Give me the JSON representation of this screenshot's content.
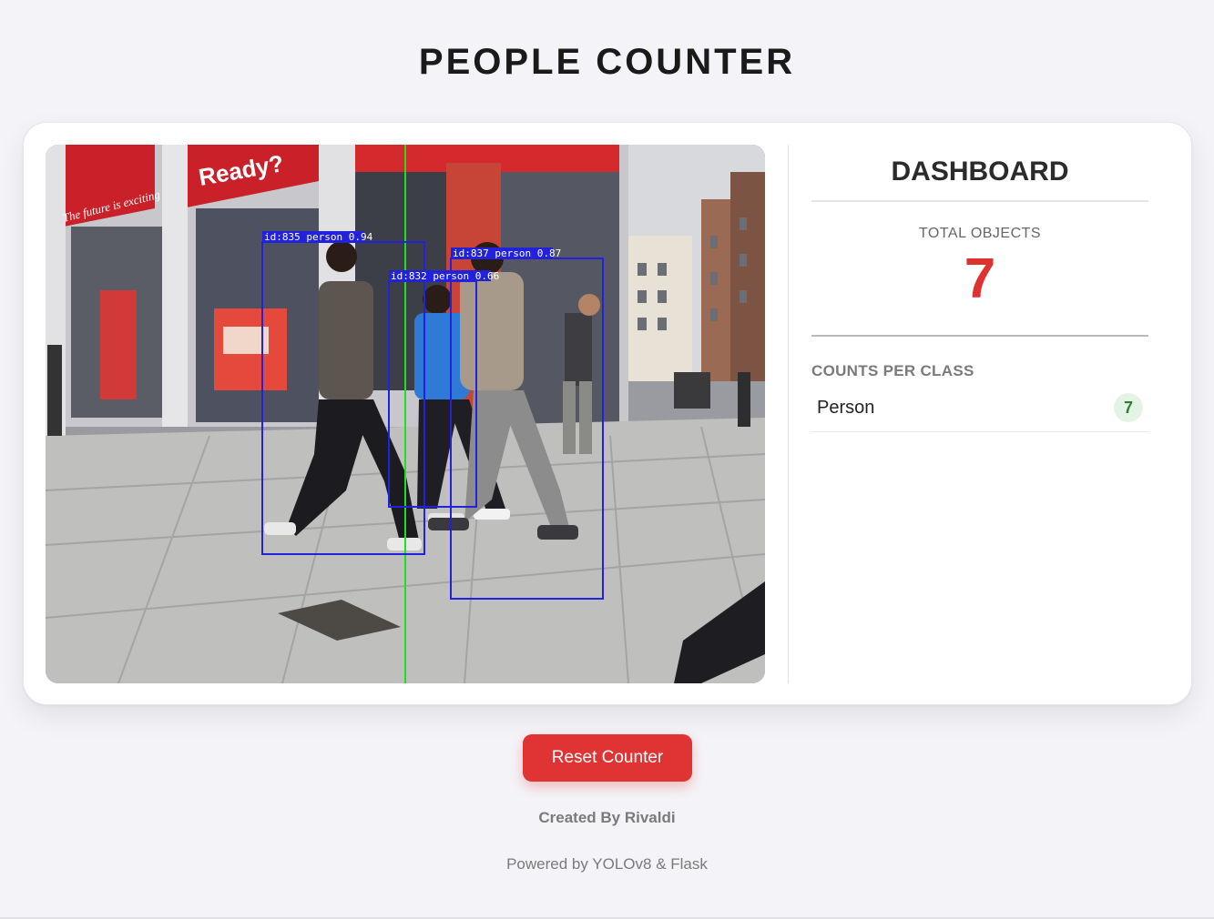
{
  "header": {
    "title": "PEOPLE COUNTER"
  },
  "video": {
    "line_color": "#22dd22",
    "box_color": "#2222dd",
    "detections": [
      {
        "label": "id:835 person 0.94"
      },
      {
        "label": "id:837 person 0.87"
      },
      {
        "label": "id:832 person 0.66"
      }
    ],
    "sign_ready": "Ready?",
    "sign_exciting": "The future is exciting"
  },
  "dashboard": {
    "title": "DASHBOARD",
    "total_label": "TOTAL OBJECTS",
    "total_value": "7",
    "class_heading": "COUNTS PER CLASS",
    "classes": [
      {
        "name": "Person",
        "count": "7"
      }
    ]
  },
  "actions": {
    "reset_label": "Reset Counter"
  },
  "footer": {
    "credit": "Created By Rivaldi",
    "powered": "Powered by YOLOv8 & Flask"
  },
  "colors": {
    "accent": "#e03131",
    "badge_bg": "#e4f4e4",
    "badge_text": "#2e7d32"
  }
}
